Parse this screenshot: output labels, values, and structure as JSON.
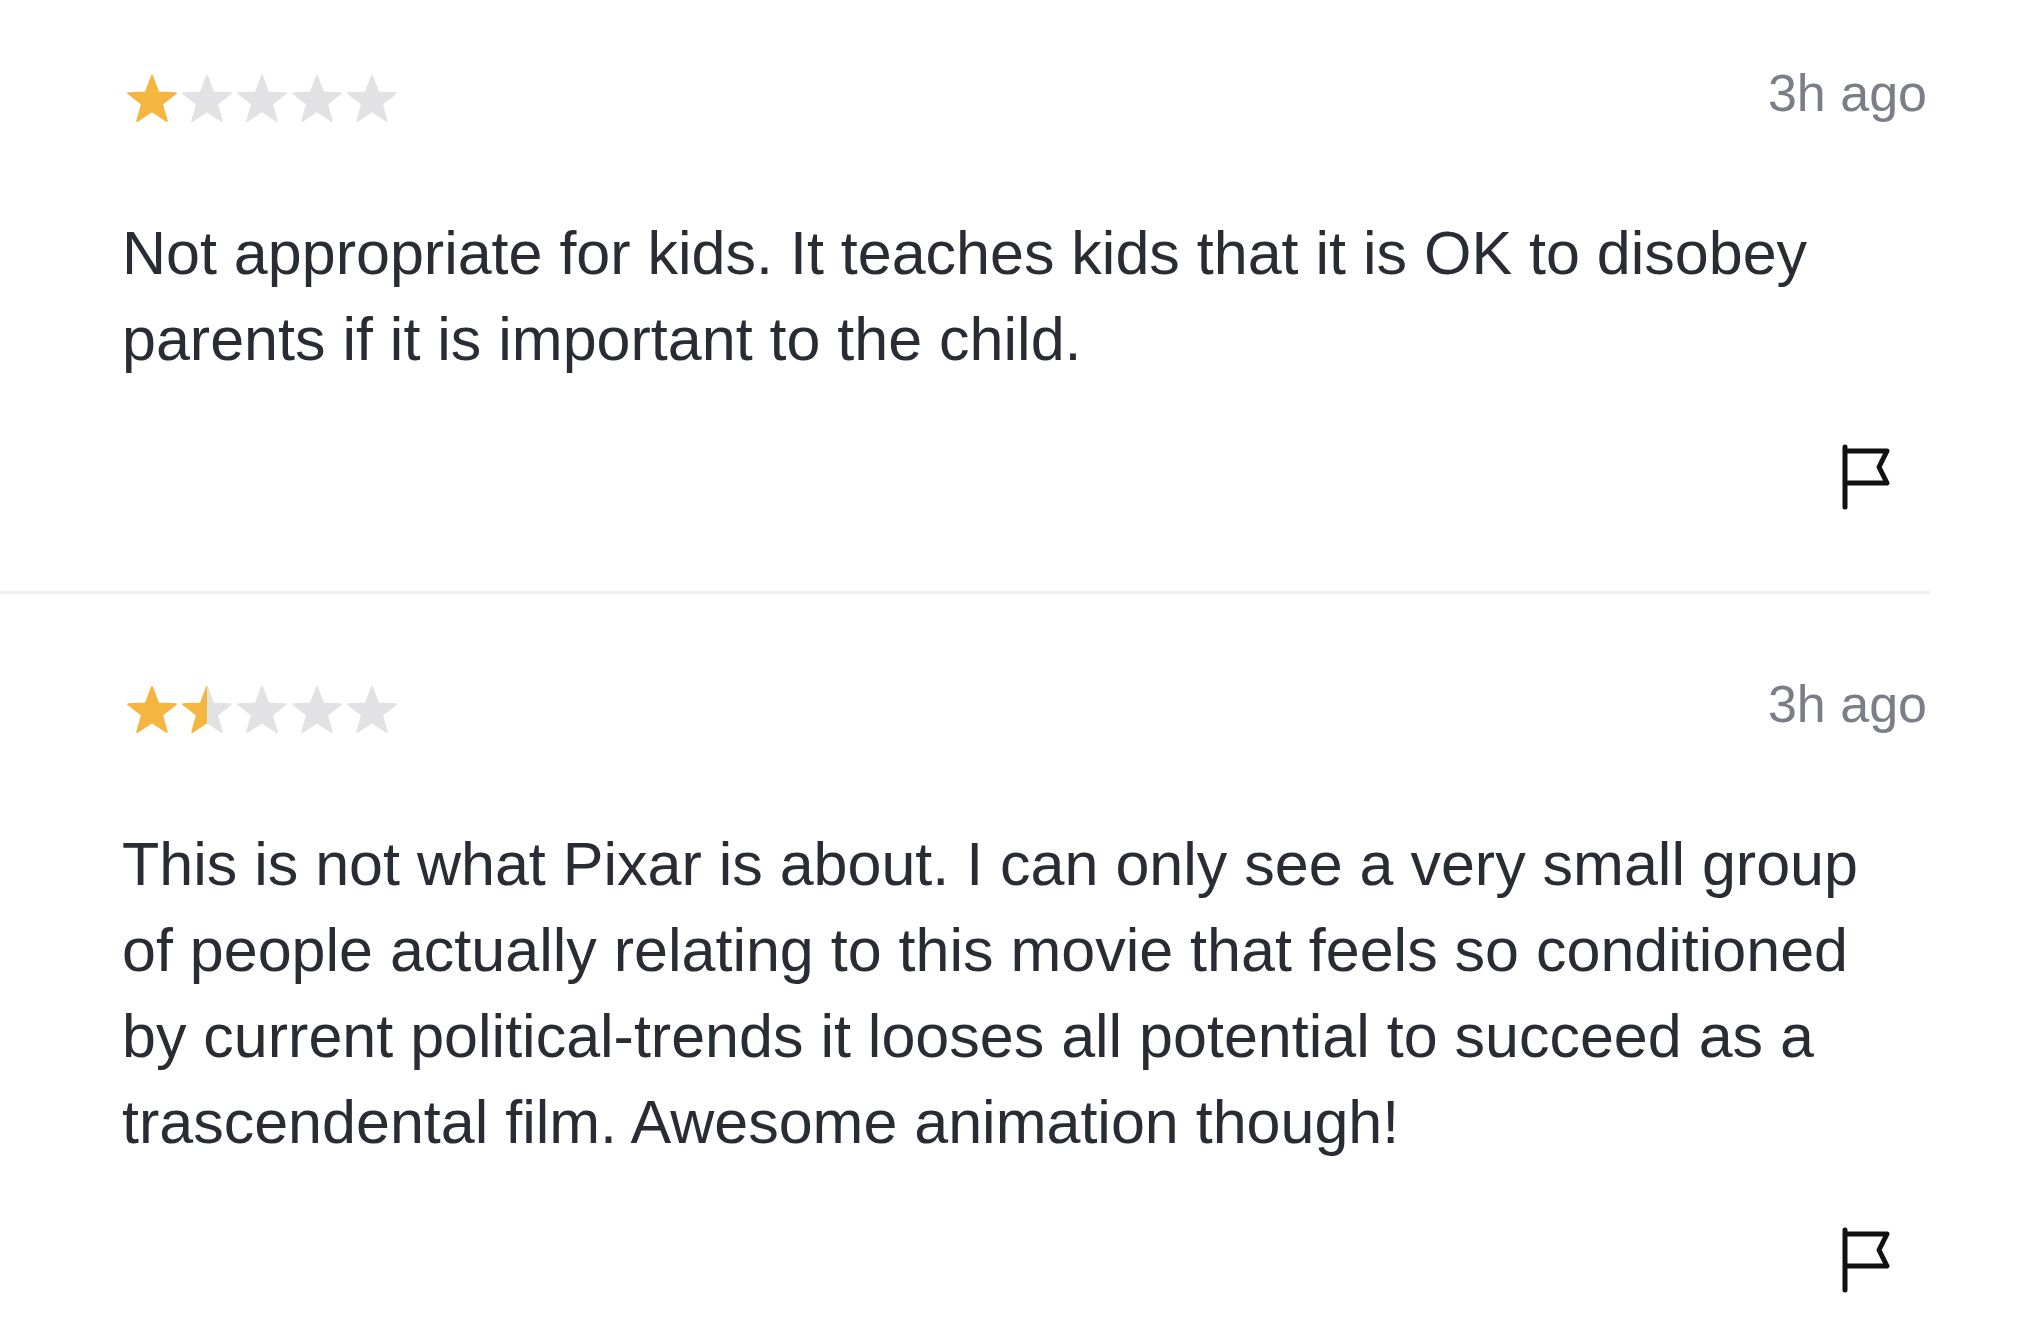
{
  "reviews": [
    {
      "stars": 1,
      "time": "3h ago",
      "text": "Not appropriate for kids. It teaches kids that it is OK to disobey parents if it is important to the child."
    },
    {
      "stars": 1.5,
      "time": "3h ago",
      "text": "This is not what Pixar is about. I can only see a very small group of people actually relating to this movie that feels so conditioned by current political-trends it looses all potential to succeed as a trascendental film. Awesome animation though!"
    }
  ]
}
